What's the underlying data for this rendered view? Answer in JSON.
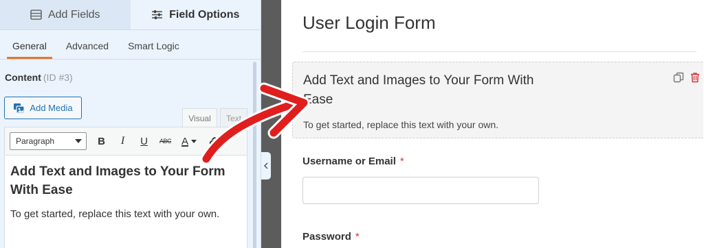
{
  "panel": {
    "tabs": [
      {
        "label": "Add Fields",
        "icon": "list-icon"
      },
      {
        "label": "Field Options",
        "icon": "sliders-icon"
      }
    ],
    "subtabs": [
      "General",
      "Advanced",
      "Smart Logic"
    ],
    "content_label": "Content",
    "content_id": "(ID #3)",
    "add_media_label": "Add Media",
    "editor_tabs": [
      "Visual",
      "Text"
    ],
    "format_value": "Paragraph",
    "toolbar_labels": {
      "bold": "B",
      "italic": "I",
      "underline": "U",
      "strike": "ABC",
      "text_color": "A"
    },
    "editor_heading": "Add Text and Images to Your Form With Ease",
    "editor_paragraph": "To get started, replace this text with your own."
  },
  "preview": {
    "form_title": "User Login Form",
    "block_heading": "Add Text and Images to Your Form With Ease",
    "block_paragraph": "To get started, replace this text with your own.",
    "fields": [
      {
        "label": "Username or Email",
        "required_mark": "*"
      },
      {
        "label": "Password",
        "required_mark": "*"
      }
    ]
  },
  "colors": {
    "accent_orange": "#e27730",
    "link_blue": "#2271b1",
    "required_red": "#d63638",
    "arrow_red": "#e01e1e"
  }
}
